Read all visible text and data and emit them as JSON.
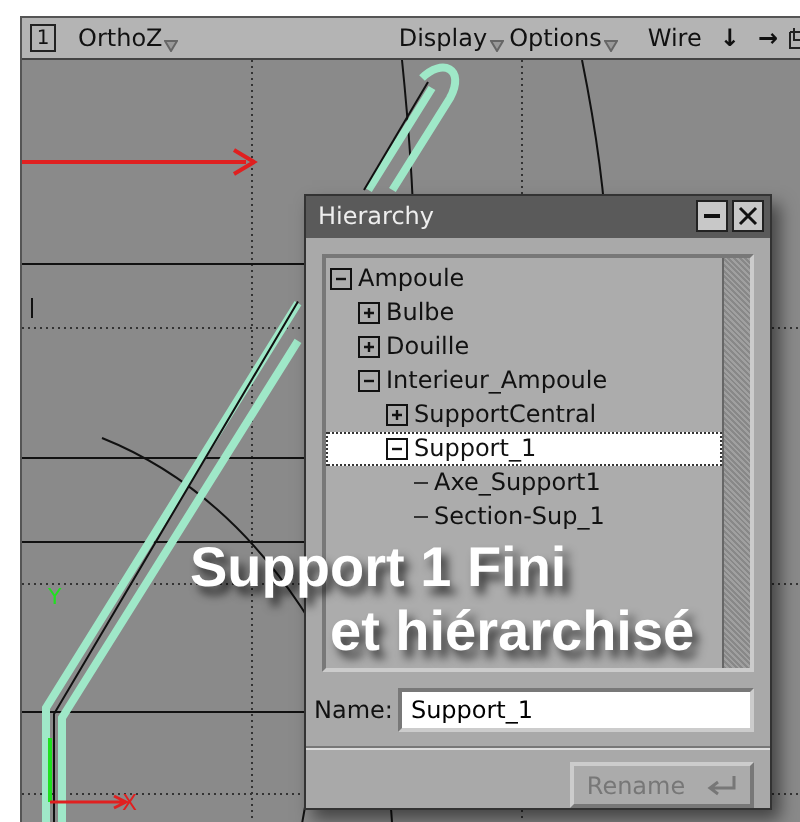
{
  "viewport": {
    "number": "1",
    "camera": "OrthoZ",
    "menus": [
      "Display",
      "Options"
    ],
    "mode": "Wire",
    "tools": [
      "↓",
      "→"
    ],
    "axes": {
      "x": "X",
      "y": "Y"
    }
  },
  "hierarchy": {
    "title": "Hierarchy",
    "tree": [
      {
        "label": "Ampoule",
        "expanded": true,
        "selected": false,
        "children": [
          {
            "label": "Bulbe",
            "expanded": false,
            "selected": false
          },
          {
            "label": "Douille",
            "expanded": false,
            "selected": false
          },
          {
            "label": "Interieur_Ampoule",
            "expanded": true,
            "selected": false,
            "children": [
              {
                "label": "SupportCentral",
                "expanded": false,
                "selected": false
              },
              {
                "label": "Support_1",
                "expanded": true,
                "selected": true,
                "children": [
                  {
                    "label": "Axe_Support1",
                    "selected": false
                  },
                  {
                    "label": "Section-Sup_1",
                    "selected": false
                  }
                ]
              }
            ]
          }
        ]
      }
    ],
    "name_label": "Name:",
    "name_value": "Support_1",
    "rename_button": {
      "label": "Rename",
      "disabled": true
    }
  },
  "caption": [
    "Support 1 Fini",
    "et hiérarchisé"
  ]
}
